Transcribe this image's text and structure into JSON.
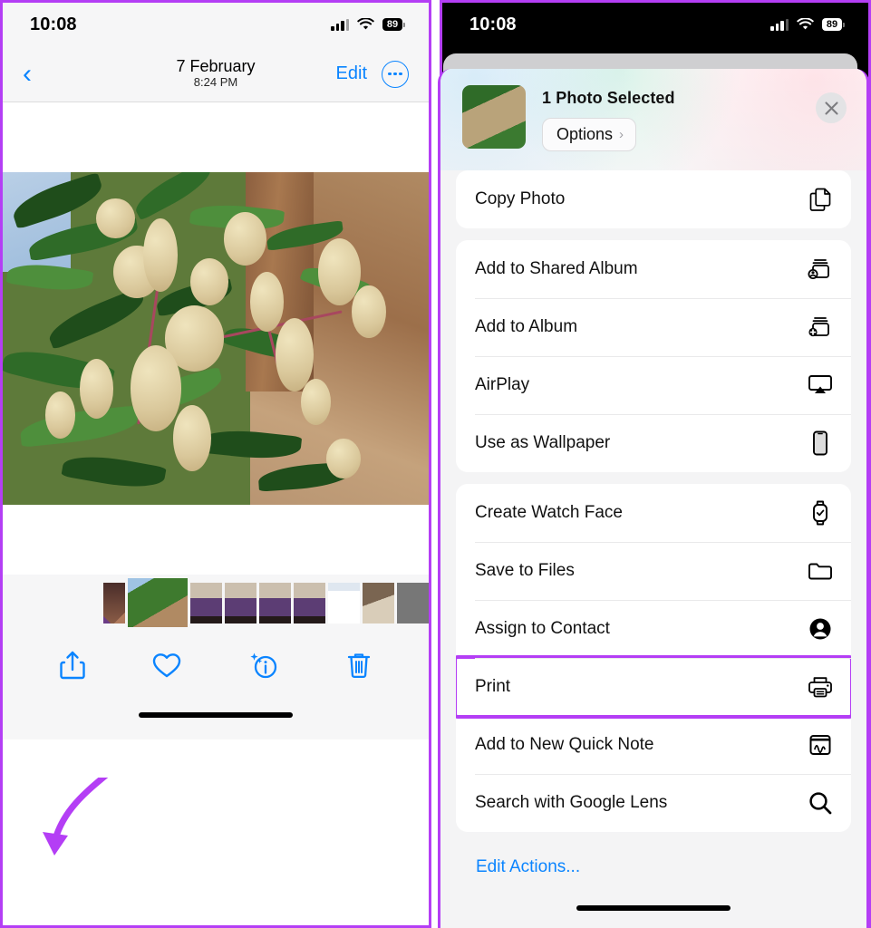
{
  "accent": {
    "purple": "#b43ef5",
    "blue": "#0a84ff"
  },
  "left_phone": {
    "status_bar": {
      "time": "10:08",
      "battery": "89",
      "signal_icon": "cellular-bars-icon",
      "wifi_icon": "wifi-icon",
      "battery_icon": "battery-icon"
    },
    "nav": {
      "back_icon": "chevron-left-icon",
      "date": "7 February",
      "time": "8:24 PM",
      "edit_label": "Edit",
      "more_icon": "ellipsis-circle-icon"
    },
    "photo": {
      "alt": "Mango tree branch with flower panicles"
    },
    "thumbnails": [
      {
        "name": "collage-thumbnail",
        "kind": "collage"
      },
      {
        "name": "plant-thumbnail",
        "kind": "plant",
        "selected": true
      },
      {
        "name": "selfie-thumbnail-1",
        "kind": "selfie"
      },
      {
        "name": "selfie-thumbnail-2",
        "kind": "selfie"
      },
      {
        "name": "selfie-thumbnail-3",
        "kind": "selfie"
      },
      {
        "name": "selfie-thumbnail-4",
        "kind": "selfie"
      },
      {
        "name": "document-thumbnail",
        "kind": "doc"
      },
      {
        "name": "room-thumbnail-1",
        "kind": "room"
      },
      {
        "name": "room-thumbnail-2",
        "kind": "room2"
      }
    ],
    "toolbar": [
      {
        "name": "share-button",
        "icon": "share-icon"
      },
      {
        "name": "favorite-button",
        "icon": "heart-icon"
      },
      {
        "name": "info-button",
        "icon": "info-sparkle-icon"
      },
      {
        "name": "delete-button",
        "icon": "trash-icon"
      }
    ],
    "annotation": {
      "arrow": "curved-arrow-to-share-button",
      "color": "#b43ef5"
    }
  },
  "right_phone": {
    "status_bar": {
      "time": "10:08",
      "battery": "89",
      "signal_icon": "cellular-bars-icon",
      "wifi_icon": "wifi-icon",
      "battery_icon": "battery-icon"
    },
    "share_sheet": {
      "title": "1 Photo Selected",
      "options_label": "Options",
      "options_chevron": "chevron-right-icon",
      "close_icon": "close-icon",
      "thumbnail": "selected-photo-thumbnail",
      "groups": [
        {
          "name": "group-copy",
          "items": [
            {
              "label": "Copy Photo",
              "icon": "copy-icon",
              "highlighted": false
            }
          ]
        },
        {
          "name": "group-albums",
          "items": [
            {
              "label": "Add to Shared Album",
              "icon": "shared-album-icon",
              "highlighted": false
            },
            {
              "label": "Add to Album",
              "icon": "add-album-icon",
              "highlighted": false
            },
            {
              "label": "AirPlay",
              "icon": "airplay-icon",
              "highlighted": false
            },
            {
              "label": "Use as Wallpaper",
              "icon": "wallpaper-icon",
              "highlighted": false
            }
          ]
        },
        {
          "name": "group-actions",
          "items": [
            {
              "label": "Create Watch Face",
              "icon": "watch-icon",
              "highlighted": false
            },
            {
              "label": "Save to Files",
              "icon": "folder-icon",
              "highlighted": false
            },
            {
              "label": "Assign to Contact",
              "icon": "contact-icon",
              "highlighted": false
            },
            {
              "label": "Print",
              "icon": "printer-icon",
              "highlighted": true
            },
            {
              "label": "Add to New Quick Note",
              "icon": "quick-note-icon",
              "highlighted": false
            },
            {
              "label": "Search with Google Lens",
              "icon": "search-icon",
              "highlighted": false
            }
          ]
        }
      ],
      "edit_actions_label": "Edit Actions..."
    }
  }
}
